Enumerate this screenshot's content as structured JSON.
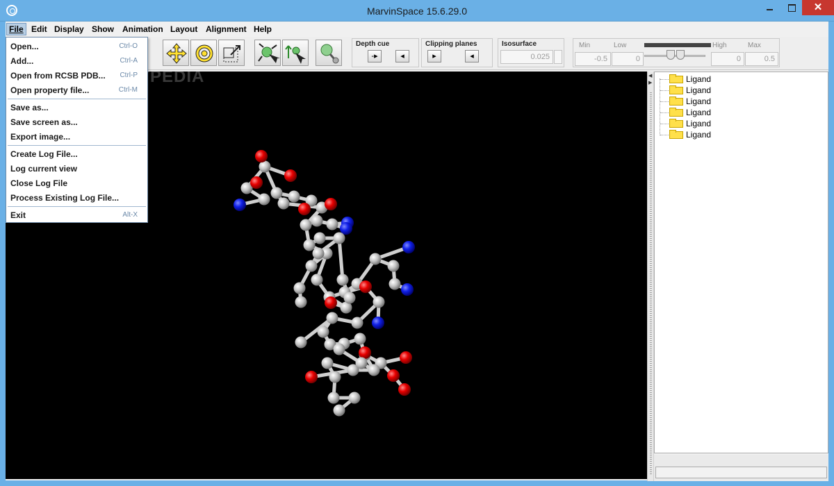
{
  "window": {
    "title": "MarvinSpace 15.6.29.0",
    "close_glyph": "✕"
  },
  "menubar": {
    "items": [
      "File",
      "Edit",
      "Display",
      "Show",
      "Animation",
      "Layout",
      "Alignment",
      "Help"
    ],
    "active": "File"
  },
  "toolbar": {
    "buttons": [
      "move-arrows-icon",
      "target-circle-icon",
      "resize-box-icon",
      "atom-select-icon",
      "atom-move-icon",
      "atom-ball-icon"
    ],
    "depth_cue": {
      "label": "Depth cue",
      "minus": "-"
    },
    "clipping": {
      "label": "Clipping planes"
    },
    "isosurface": {
      "label": "Isosurface",
      "value": "0.025"
    },
    "range": {
      "min_label": "Min",
      "low_label": "Low",
      "high_label": "High",
      "max_label": "Max",
      "min_value": "-0.5",
      "low_value": "0",
      "high_value": "0",
      "max_value": "0.5"
    }
  },
  "file_menu": {
    "groups": [
      [
        {
          "label": "Open...",
          "shortcut": "Ctrl-O"
        },
        {
          "label": "Add...",
          "shortcut": "Ctrl-A"
        },
        {
          "label": "Open from RCSB PDB...",
          "shortcut": "Ctrl-P"
        },
        {
          "label": "Open property file...",
          "shortcut": "Ctrl-M"
        }
      ],
      [
        {
          "label": "Save as...",
          "shortcut": ""
        },
        {
          "label": "Save screen as...",
          "shortcut": ""
        },
        {
          "label": "Export image...",
          "shortcut": ""
        }
      ],
      [
        {
          "label": "Create Log File...",
          "shortcut": ""
        },
        {
          "label": "Log current view",
          "shortcut": ""
        },
        {
          "label": "Close Log File",
          "shortcut": ""
        },
        {
          "label": "Process Existing Log File...",
          "shortcut": ""
        }
      ],
      [
        {
          "label": "Exit",
          "shortcut": "Alt-X"
        }
      ]
    ]
  },
  "viewport": {
    "watermark": "SOFTPEDIA",
    "colors": {
      "carbon": "#c8c8c8",
      "oxygen": "#e00000",
      "nitrogen": "#1020e0"
    }
  },
  "tree": {
    "items": [
      "Ligand",
      "Ligand",
      "Ligand",
      "Ligand",
      "Ligand",
      "Ligand"
    ]
  }
}
